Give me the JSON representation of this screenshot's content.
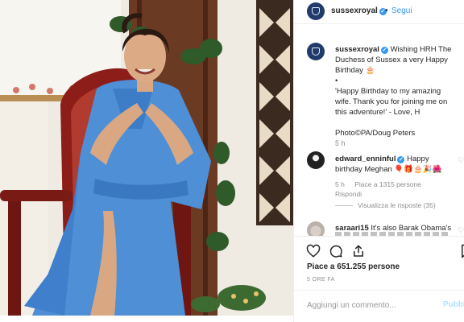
{
  "post": {
    "username": "sussexroyal",
    "follow_separator": "•",
    "follow_label": "Segui"
  },
  "caption": {
    "username": "sussexroyal",
    "line1": "Wishing HRH The Duchess of Sussex a very Happy Birthday 🎂",
    "bullet": "•",
    "quote": "'Happy Birthday to my amazing wife. Thank you for joining me on this adventure!' - Love, H",
    "credit": "Photo©PA/Doug Peters",
    "time": "5 h"
  },
  "comments": [
    {
      "username": "edward_enninful",
      "text": "Happy birthday Meghan 🎈🎁🎂🎉🌺",
      "time": "5 h",
      "likes": "Piace a 1315 persone",
      "reply_label": "Rispondi",
      "view_replies": "Visualizza le risposte (35)"
    },
    {
      "username": "saraari15",
      "text": "It's also Barak Obama's"
    }
  ],
  "actions": {
    "heart": "heart-icon",
    "comment": "comment-icon",
    "share": "share-icon",
    "save": "bookmark-icon"
  },
  "likes_text": "Piace a 651.255 persone",
  "time_ago": "5 ORE FA",
  "add_comment": {
    "placeholder": "Aggiungi un commento...",
    "publish_label": "Pubblica"
  },
  "colors": {
    "link_blue": "#3897f0",
    "dress_blue": "#4f8fd6",
    "chair_red": "#8c1d18",
    "brand_navy": "#1f3a6b"
  }
}
